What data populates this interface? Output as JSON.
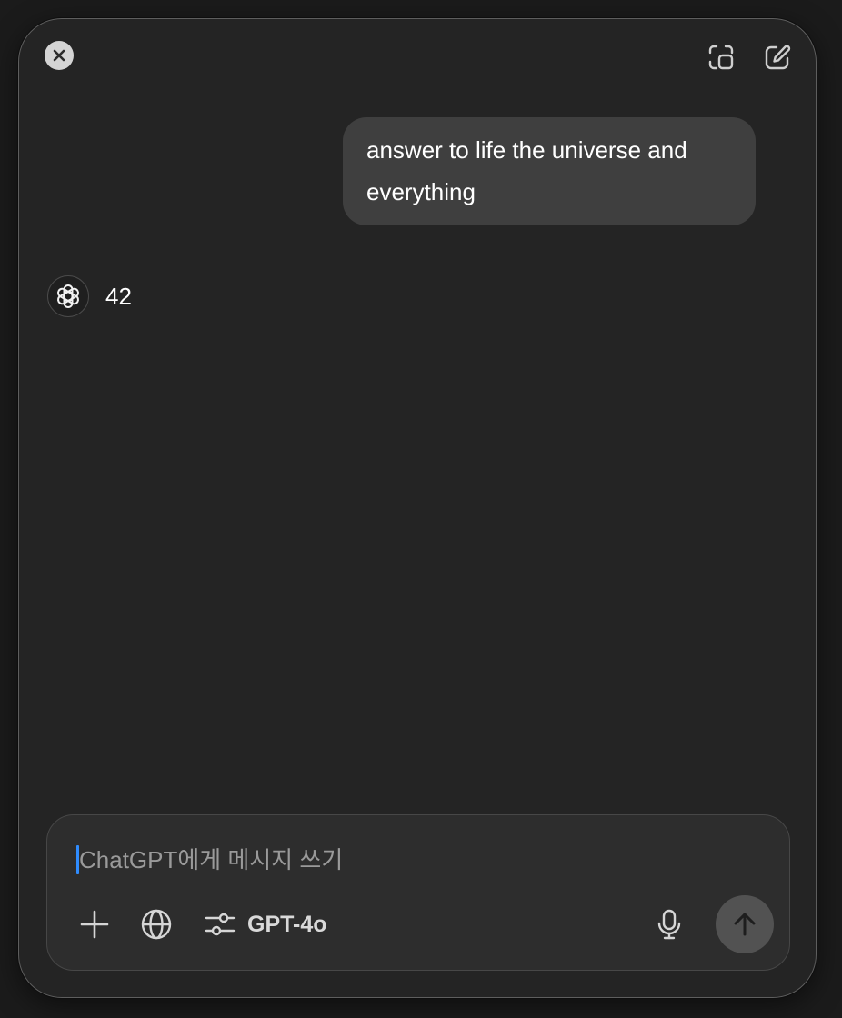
{
  "window": {
    "controls": {
      "close_icon": "close-icon",
      "new_window_icon": "new-window-icon",
      "compose_icon": "compose-icon"
    }
  },
  "conversation": {
    "user_message": "answer to life the universe and everything",
    "assistant_message": "42",
    "assistant_avatar_icon": "openai-logo-icon"
  },
  "composer": {
    "placeholder": "ChatGPT에게 메시지 쓰기",
    "value": "",
    "add_icon": "plus-icon",
    "web_icon": "globe-icon",
    "model_icon": "sliders-icon",
    "model_label": "GPT-4o",
    "mic_icon": "microphone-icon",
    "send_icon": "arrow-up-icon"
  },
  "colors": {
    "background": "#242424",
    "user_bubble": "#3f3f3f",
    "composer": "#2d2d2d",
    "caret": "#2f8cff",
    "send_button": "#525252"
  }
}
